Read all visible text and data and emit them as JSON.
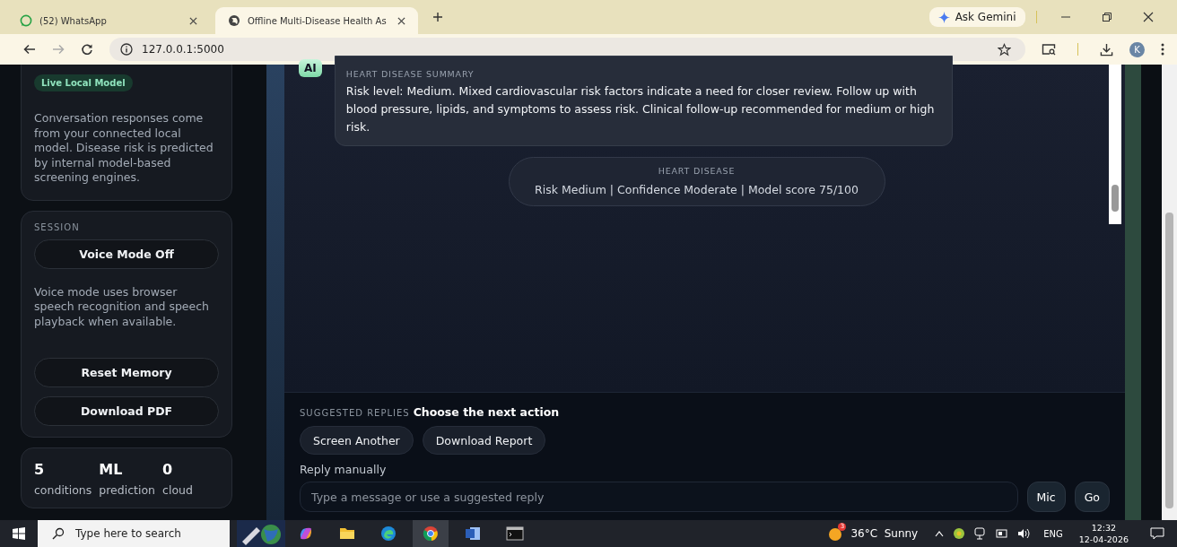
{
  "browser": {
    "tabs": [
      {
        "title": "(52) WhatsApp",
        "kind": "chat",
        "selected": false
      },
      {
        "title": "Offline Multi-Disease Health As",
        "kind": "globe",
        "selected": true
      }
    ],
    "url": "127.0.0.1:5000",
    "gemini": "Ask Gemini",
    "profile": "K"
  },
  "sidebar": {
    "badge": "Live Local Model",
    "about": "Conversation responses come from your connected local model. Disease risk is predicted by internal model-based screening engines.",
    "session": {
      "heading": "SESSION",
      "voice_button": "Voice Mode Off",
      "voice_text": "Voice mode uses browser speech recognition and speech playback when available.",
      "buttons": [
        "Reset Memory",
        "Download PDF"
      ]
    },
    "stats": [
      {
        "value": "5",
        "label": "conditions"
      },
      {
        "value": "ML",
        "label": "prediction"
      },
      {
        "value": "0",
        "label": "cloud"
      }
    ]
  },
  "chat": {
    "message": {
      "avatar": "AI",
      "heading": "HEART DISEASE SUMMARY",
      "text": "Risk level: Medium. Mixed cardiovascular risk factors indicate a need for closer review. Follow up with blood pressure, lipids, and symptoms to assess risk. Clinical follow-up recommended for medium or high risk."
    },
    "result": {
      "heading": "HEART DISEASE",
      "text": "Risk Medium | Confidence Moderate | Model score 75/100"
    }
  },
  "composer": {
    "suggested_label": "SUGGESTED REPLIES",
    "suggested_title": "Choose the next action",
    "suggestions": [
      "Screen Another",
      "Download Report"
    ],
    "manual_label": "Reply manually",
    "placeholder": "Type a message or use a suggested reply",
    "mic": "Mic",
    "go": "Go"
  },
  "taskbar": {
    "search": "Type here to search",
    "weather": "36°C  Sunny",
    "weather_badge": "3",
    "lang": "ENG",
    "time": "12:32",
    "date": "12-04-2026"
  }
}
